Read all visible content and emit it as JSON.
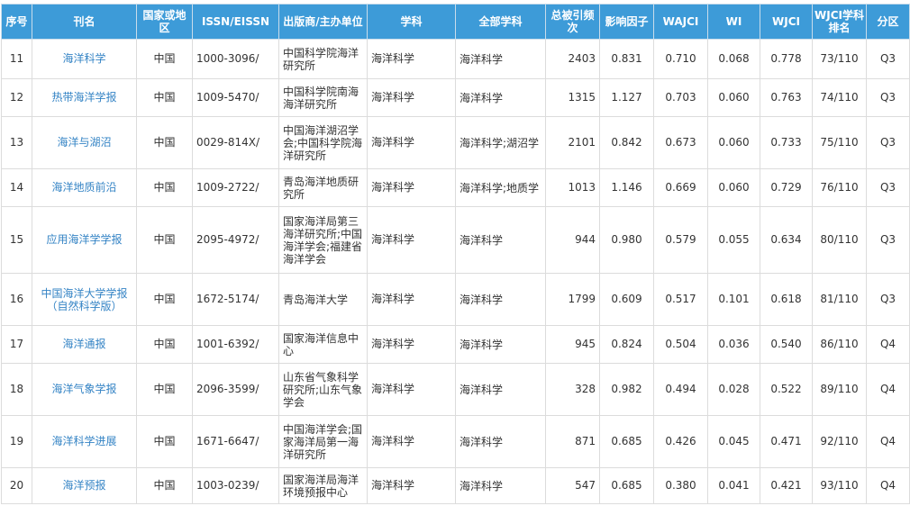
{
  "headers": [
    "序号",
    "刊名",
    "国家或地区",
    "ISSN/EISSN",
    "出版商/主办单位",
    "学科",
    "全部学科",
    "总被引频次",
    "影响因子",
    "WAJCI",
    "WI",
    "WJCI",
    "WJCI学科排名",
    "分区"
  ],
  "rows": [
    {
      "no": "11",
      "name": "海洋科学",
      "country": "中国",
      "issn": "1000-3096/",
      "publisher": "中国科学院海洋研究所",
      "subject": "海洋科学",
      "all_subjects": "海洋科学",
      "citations": "2403",
      "if": "0.831",
      "wajci": "0.710",
      "wi": "0.068",
      "wjci": "0.778",
      "rank": "73/110",
      "zone": "Q3"
    },
    {
      "no": "12",
      "name": "热带海洋学报",
      "country": "中国",
      "issn": "1009-5470/",
      "publisher": "中国科学院南海海洋研究所",
      "subject": "海洋科学",
      "all_subjects": "海洋科学",
      "citations": "1315",
      "if": "1.127",
      "wajci": "0.703",
      "wi": "0.060",
      "wjci": "0.763",
      "rank": "74/110",
      "zone": "Q3"
    },
    {
      "no": "13",
      "name": "海洋与湖沼",
      "country": "中国",
      "issn": "0029-814X/",
      "publisher": "中国海洋湖沼学会;中国科学院海洋研究所",
      "subject": "海洋科学",
      "all_subjects": "海洋科学;湖沼学",
      "citations": "2101",
      "if": "0.842",
      "wajci": "0.673",
      "wi": "0.060",
      "wjci": "0.733",
      "rank": "75/110",
      "zone": "Q3"
    },
    {
      "no": "14",
      "name": "海洋地质前沿",
      "country": "中国",
      "issn": "1009-2722/",
      "publisher": "青岛海洋地质研究所",
      "subject": "海洋科学",
      "all_subjects": "海洋科学;地质学",
      "citations": "1013",
      "if": "1.146",
      "wajci": "0.669",
      "wi": "0.060",
      "wjci": "0.729",
      "rank": "76/110",
      "zone": "Q3"
    },
    {
      "no": "15",
      "name": "应用海洋学学报",
      "country": "中国",
      "issn": "2095-4972/",
      "publisher": "国家海洋局第三海洋研究所;中国海洋学会;福建省海洋学会",
      "subject": "海洋科学",
      "all_subjects": "海洋科学",
      "citations": "944",
      "if": "0.980",
      "wajci": "0.579",
      "wi": "0.055",
      "wjci": "0.634",
      "rank": "80/110",
      "zone": "Q3"
    },
    {
      "no": "16",
      "name": "中国海洋大学学报（自然科学版）",
      "country": "中国",
      "issn": "1672-5174/",
      "publisher": "青岛海洋大学",
      "subject": "海洋科学",
      "all_subjects": "海洋科学",
      "citations": "1799",
      "if": "0.609",
      "wajci": "0.517",
      "wi": "0.101",
      "wjci": "0.618",
      "rank": "81/110",
      "zone": "Q3"
    },
    {
      "no": "17",
      "name": "海洋通报",
      "country": "中国",
      "issn": "1001-6392/",
      "publisher": "国家海洋信息中心",
      "subject": "海洋科学",
      "all_subjects": "海洋科学",
      "citations": "945",
      "if": "0.824",
      "wajci": "0.504",
      "wi": "0.036",
      "wjci": "0.540",
      "rank": "86/110",
      "zone": "Q4"
    },
    {
      "no": "18",
      "name": "海洋气象学报",
      "country": "中国",
      "issn": "2096-3599/",
      "publisher": "山东省气象科学研究所;山东气象学会",
      "subject": "海洋科学",
      "all_subjects": "海洋科学",
      "citations": "328",
      "if": "0.982",
      "wajci": "0.494",
      "wi": "0.028",
      "wjci": "0.522",
      "rank": "89/110",
      "zone": "Q4"
    },
    {
      "no": "19",
      "name": "海洋科学进展",
      "country": "中国",
      "issn": "1671-6647/",
      "publisher": "中国海洋学会;国家海洋局第一海洋研究所",
      "subject": "海洋科学",
      "all_subjects": "海洋科学",
      "citations": "871",
      "if": "0.685",
      "wajci": "0.426",
      "wi": "0.045",
      "wjci": "0.471",
      "rank": "92/110",
      "zone": "Q4"
    },
    {
      "no": "20",
      "name": "海洋预报",
      "country": "中国",
      "issn": "1003-0239/",
      "publisher": "国家海洋局海洋环境预报中心",
      "subject": "海洋科学",
      "all_subjects": "海洋科学",
      "citations": "547",
      "if": "0.685",
      "wajci": "0.380",
      "wi": "0.041",
      "wjci": "0.421",
      "rank": "93/110",
      "zone": "Q4"
    }
  ]
}
